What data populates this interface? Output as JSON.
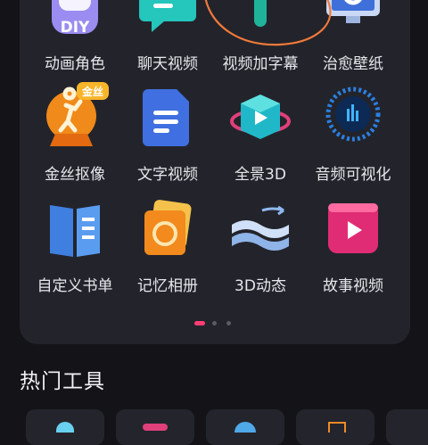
{
  "grid": {
    "row1": [
      {
        "label": "动画角色",
        "icon": "diy-avatar-icon"
      },
      {
        "label": "聊天视频",
        "icon": "chat-bubble-icon"
      },
      {
        "label": "视频加字幕",
        "icon": "subtitle-t-icon"
      },
      {
        "label": "治愈壁纸",
        "icon": "monitor-gear-icon"
      }
    ],
    "row2": [
      {
        "label": "金丝抠像",
        "icon": "gold-cutout-icon",
        "badge": "金丝"
      },
      {
        "label": "文字视频",
        "icon": "text-document-icon"
      },
      {
        "label": "全景3D",
        "icon": "panorama-cube-icon"
      },
      {
        "label": "音频可视化",
        "icon": "audio-visualizer-icon"
      }
    ],
    "row3": [
      {
        "label": "自定义书单",
        "icon": "book-list-icon"
      },
      {
        "label": "记忆相册",
        "icon": "photo-album-icon"
      },
      {
        "label": "3D动态",
        "icon": "3d-layers-icon"
      },
      {
        "label": "故事视频",
        "icon": "story-play-icon"
      }
    ]
  },
  "pager": {
    "count": 3,
    "active": 0
  },
  "section": {
    "title": "热门工具"
  },
  "colors": {
    "background": "#131318",
    "panel": "#23242b",
    "accent": "#ff3d77",
    "annotation": "#f07a3a"
  }
}
